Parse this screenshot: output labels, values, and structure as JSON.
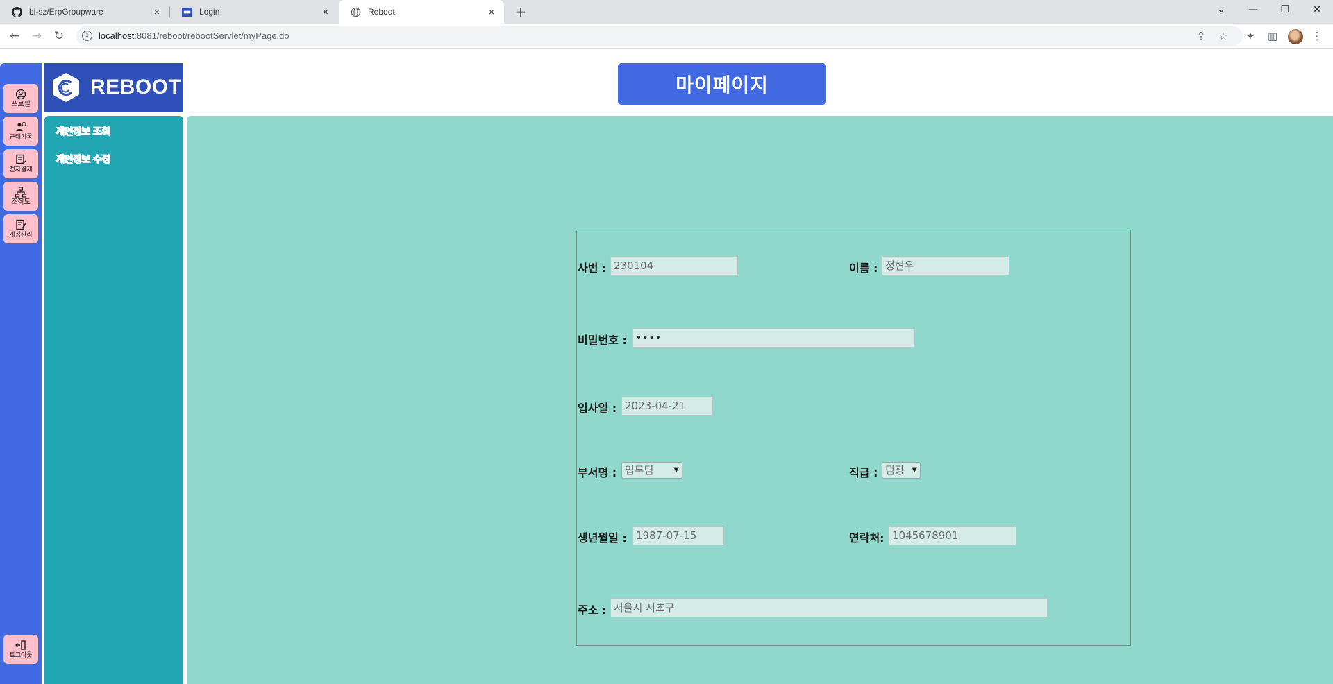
{
  "browser": {
    "tabs": [
      {
        "label": "bi-sz/ErpGroupware",
        "icon": "github-icon"
      },
      {
        "label": "Login",
        "icon": "site-icon"
      },
      {
        "label": "Reboot",
        "icon": "globe-icon"
      }
    ],
    "new_tab": "+",
    "close": "×",
    "url_host": "localhost",
    "url_rest": ":8081/reboot/rebootServlet/myPage.do"
  },
  "sidebar": {
    "items": [
      {
        "label": "프로필",
        "icon": "profile-icon"
      },
      {
        "label": "근태기록",
        "icon": "attendance-icon"
      },
      {
        "label": "전자결재",
        "icon": "approval-icon"
      },
      {
        "label": "조직도",
        "icon": "org-chart-icon"
      },
      {
        "label": "계정관리",
        "icon": "account-manage-icon"
      }
    ],
    "logout": {
      "label": "로그아웃",
      "icon": "logout-icon"
    }
  },
  "logo": {
    "text": "REBOOT"
  },
  "subnav": {
    "items": [
      "개인정보 조회",
      "개인정보 수정"
    ]
  },
  "page": {
    "title": "마이페이지"
  },
  "form": {
    "emp_no": {
      "label": "사번 :",
      "value": "230104"
    },
    "name": {
      "label": "이름 :",
      "value": "정현우"
    },
    "password": {
      "label": "비밀번호 :",
      "value": "••••"
    },
    "hire_date": {
      "label": "입사일 :",
      "value": "2023-04-21"
    },
    "department": {
      "label": "부서명 :",
      "value": "업무팀"
    },
    "position": {
      "label": "직급 :",
      "value": "팀장"
    },
    "birth_date": {
      "label": "생년월일 :",
      "value": "1987-07-15"
    },
    "phone": {
      "label": "연락처:",
      "value": "1045678901"
    },
    "address": {
      "label": "주소 :",
      "value": "서울시 서초구"
    }
  },
  "colors": {
    "primary_blue": "#4169e1",
    "logo_blue": "#2f4fb8",
    "subnav_teal": "#22a6b3",
    "content_mint": "#8fd8cb",
    "nav_pink": "#ffc0cb"
  }
}
